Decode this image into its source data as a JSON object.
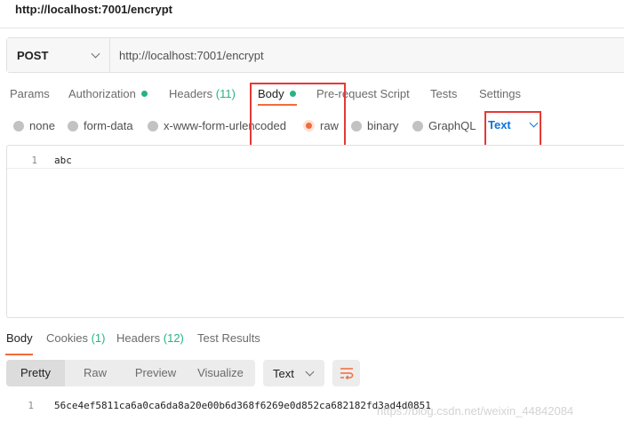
{
  "request": {
    "name": "http://localhost:7001/encrypt",
    "method": "POST",
    "url": "http://localhost:7001/encrypt"
  },
  "request_tabs": [
    {
      "label": "Params"
    },
    {
      "label": "Authorization"
    },
    {
      "label": "Headers",
      "count": "(11)"
    },
    {
      "label": "Body"
    },
    {
      "label": "Pre-request Script"
    },
    {
      "label": "Tests"
    },
    {
      "label": "Settings"
    }
  ],
  "body_types": [
    {
      "label": "none"
    },
    {
      "label": "form-data"
    },
    {
      "label": "x-www-form-urlencoded"
    },
    {
      "label": "raw",
      "selected": true
    },
    {
      "label": "binary"
    },
    {
      "label": "GraphQL"
    }
  ],
  "raw_language": "Text",
  "editor": {
    "line_number": "1",
    "content": "abc"
  },
  "response_tabs": [
    {
      "label": "Body"
    },
    {
      "label": "Cookies",
      "count": "(1)"
    },
    {
      "label": "Headers",
      "count": "(12)"
    },
    {
      "label": "Test Results"
    }
  ],
  "view_modes": [
    "Pretty",
    "Raw",
    "Preview",
    "Visualize"
  ],
  "response_format": "Text",
  "response": {
    "line_number": "1",
    "content": "56ce4ef5811ca6a0ca6da8a20e00b6d368f6269e0d852ca682182fd3ad4d0851"
  },
  "watermark": "https://blog.csdn.net/weixin_44842084",
  "colors": {
    "accent_orange": "#f26b3a",
    "status_green": "#26b47f",
    "link_blue": "#0b74de",
    "highlight_red": "#e53935"
  },
  "icons": [
    "chevron-down-icon",
    "wrap-lines-icon",
    "status-dot-icon"
  ]
}
